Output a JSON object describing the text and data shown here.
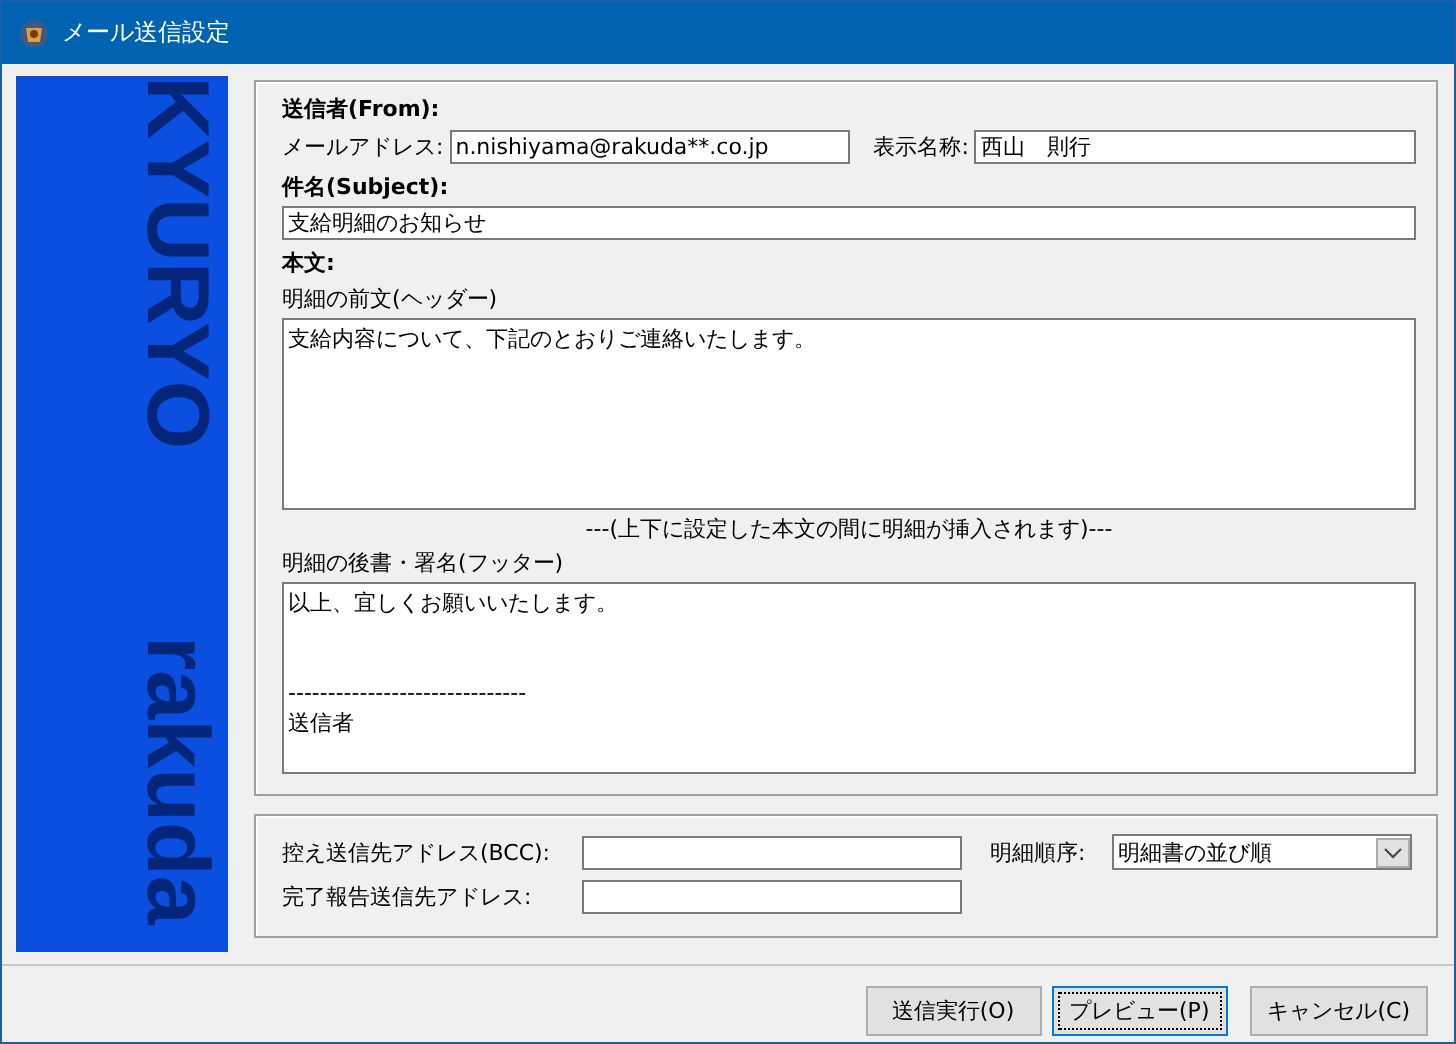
{
  "window": {
    "title": "メール送信設定"
  },
  "side_banner": {
    "texts": [
      "KYURYO",
      "rakuda"
    ]
  },
  "sender": {
    "heading": "送信者(From):",
    "address": {
      "label": "メールアドレス:",
      "value": "n.nishiyama@rakuda**.co.jp"
    },
    "display_name": {
      "label": "表示名称:",
      "value": "西山　則行"
    }
  },
  "subject": {
    "heading": "件名(Subject):",
    "value": "支給明細のお知らせ"
  },
  "body": {
    "heading": "本文:",
    "header": {
      "label": "明細の前文(ヘッダー)",
      "value": "支給内容について、下記のとおりご連絡いたします。"
    },
    "note": "---(上下に設定した本文の間に明細が挿入されます)---",
    "footer": {
      "label": "明細の後書・署名(フッター)",
      "value": "以上、宜しくお願いいたします。\n\n\n------------------------------\n送信者"
    }
  },
  "bcc": {
    "label": "控え送信先アドレス(BCC):"
  },
  "report": {
    "label": "完了報告送信先アドレス:"
  },
  "order": {
    "label": "明細順序:",
    "value": "明細書の並び順"
  },
  "buttons": [
    {
      "label": "送信実行(O)",
      "focused": false
    },
    {
      "label": "プレビュー(P)",
      "focused": true
    },
    {
      "label": "キャンセル(C)",
      "focused": false
    }
  ]
}
